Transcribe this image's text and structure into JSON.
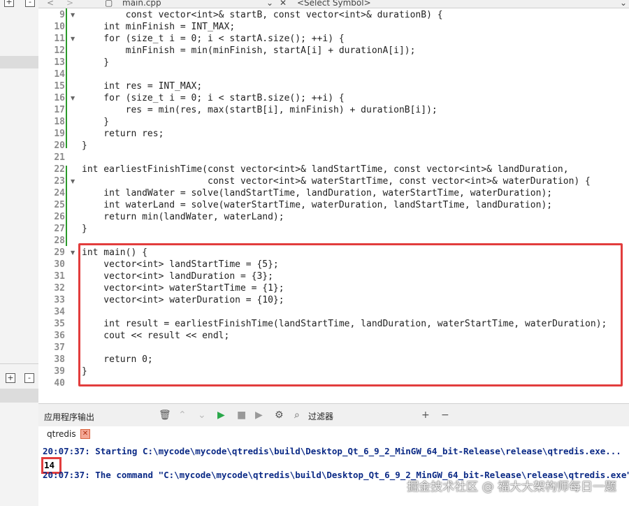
{
  "toolbar": {
    "filename": "main.cpp",
    "symbol_placeholder": "<Select Symbol>"
  },
  "editor": {
    "lines": [
      {
        "n": "9"
      },
      {
        "n": "10"
      },
      {
        "n": "11"
      },
      {
        "n": "12"
      },
      {
        "n": "13"
      },
      {
        "n": "14"
      },
      {
        "n": "15"
      },
      {
        "n": "16"
      },
      {
        "n": "17"
      },
      {
        "n": "18"
      },
      {
        "n": "19"
      },
      {
        "n": "20"
      },
      {
        "n": "21"
      },
      {
        "n": "22"
      },
      {
        "n": "23"
      },
      {
        "n": "24"
      },
      {
        "n": "25"
      },
      {
        "n": "26"
      },
      {
        "n": "27"
      },
      {
        "n": "28"
      },
      {
        "n": "29"
      },
      {
        "n": "30"
      },
      {
        "n": "31"
      },
      {
        "n": "32"
      },
      {
        "n": "33"
      },
      {
        "n": "34"
      },
      {
        "n": "35"
      },
      {
        "n": "36"
      },
      {
        "n": "37"
      },
      {
        "n": "38"
      },
      {
        "n": "39"
      },
      {
        "n": "40"
      }
    ],
    "code": {
      "l9": "        const vector<int>& startB, const vector<int>& durationB) {",
      "l10": "    int minFinish = INT_MAX;",
      "l11": "    for (size_t i = 0; i < startA.size(); ++i) {",
      "l12": "        minFinish = min(minFinish, startA[i] + durationA[i]);",
      "l13": "    }",
      "l15": "    int res = INT_MAX;",
      "l16": "    for (size_t i = 0; i < startB.size(); ++i) {",
      "l17": "        res = min(res, max(startB[i], minFinish) + durationB[i]);",
      "l18": "    }",
      "l19": "    return res;",
      "l20": "}",
      "l22": "int earliestFinishTime(const vector<int>& landStartTime, const vector<int>& landDuration,",
      "l23": "                       const vector<int>& waterStartTime, const vector<int>& waterDuration) {",
      "l24": "    int landWater = solve(landStartTime, landDuration, waterStartTime, waterDuration);",
      "l25": "    int waterLand = solve(waterStartTime, waterDuration, landStartTime, landDuration);",
      "l26": "    return min(landWater, waterLand);",
      "l27": "}",
      "l29": "int main() {",
      "l30": "    vector<int> landStartTime = {5};",
      "l31": "    vector<int> landDuration = {3};",
      "l32": "    vector<int> waterStartTime = {1};",
      "l33": "    vector<int> waterDuration = {10};",
      "l35": "    int result = earliestFinishTime(landStartTime, landDuration, waterStartTime, waterDuration);",
      "l36": "    cout << result << endl;",
      "l38": "    return 0;",
      "l39": "}"
    }
  },
  "output_pane": {
    "title": "应用程序输出",
    "filter_label": "过滤器",
    "tab_label": "qtredis",
    "lines": {
      "start": "20:07:37: Starting C:\\mycode\\mycode\\qtredis\\build\\Desktop_Qt_6_9_2_MinGW_64_bit-Release\\release\\qtredis.exe...",
      "result": "14",
      "end": "20:07:37: The command \"C:\\mycode\\mycode\\qtredis\\build\\Desktop_Qt_6_9_2_MinGW_64_bit-Release\\release\\qtredis.exe\""
    }
  },
  "watermark": "掘金技术社区 @ 福大大架构师每日一题",
  "colors": {
    "highlight_border": "#e23d3d",
    "change_bar": "#2b9a2b",
    "output_text": "#0b2a86"
  }
}
